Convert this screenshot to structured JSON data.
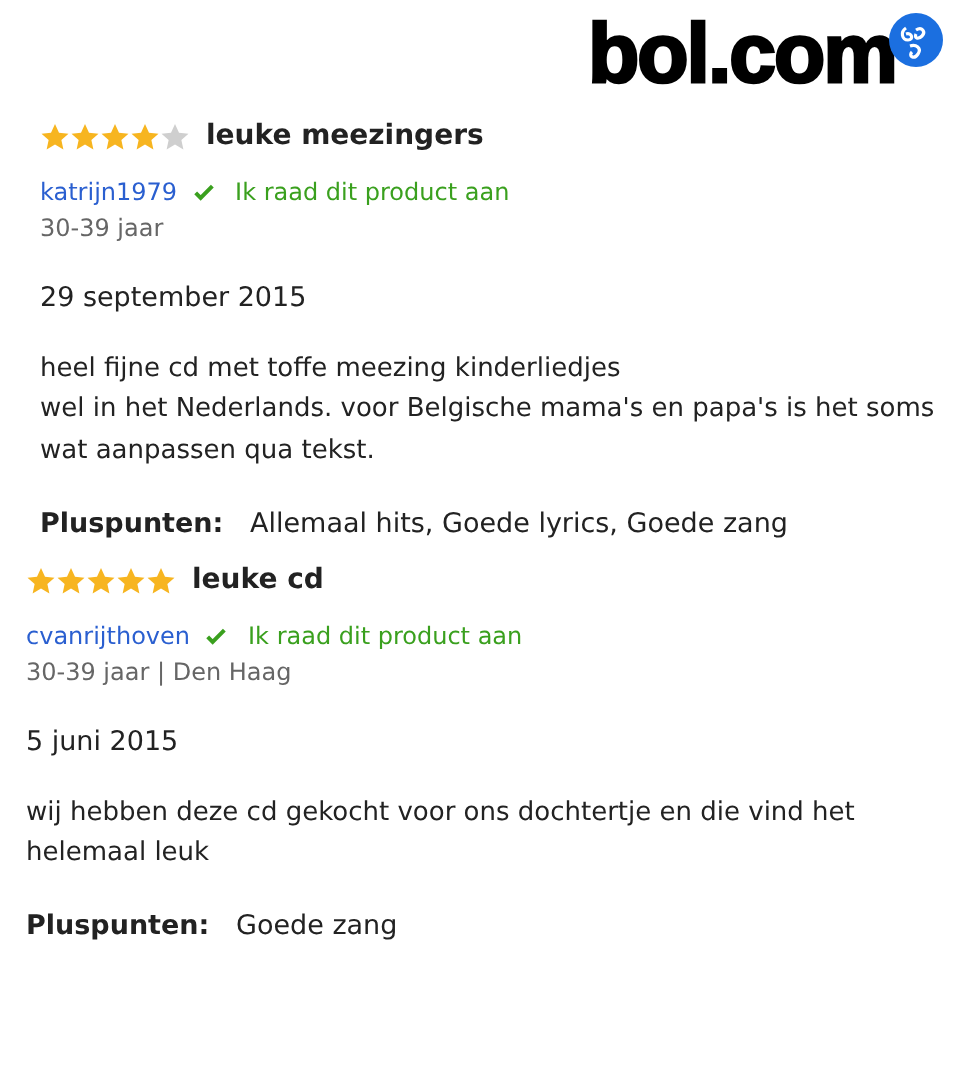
{
  "logo": {
    "text": "bol.com"
  },
  "reviews": [
    {
      "stars": 4,
      "title": "leuke meezingers",
      "author": "katrijn1979",
      "recommend": true,
      "recommend_text": "Ik raad dit product aan",
      "meta": "30-39 jaar",
      "date": "29 september 2015",
      "body": "heel fijne cd met toffe meezing kinderliedjes\nwel in het Nederlands. voor Belgische mama's en papa's is het soms wat aanpassen qua tekst.",
      "pros_label": "Pluspunten:",
      "pros": "Allemaal hits, Goede lyrics, Goede zang"
    },
    {
      "stars": 5,
      "title": "leuke cd",
      "author": "cvanrijthoven",
      "recommend": true,
      "recommend_text": "Ik raad dit product aan",
      "meta": "30-39 jaar | Den Haag",
      "date": "5 juni 2015",
      "body": "wij hebben deze cd gekocht voor ons dochtertje en die vind het helemaal leuk",
      "pros_label": "Pluspunten:",
      "pros": "Goede zang"
    }
  ]
}
